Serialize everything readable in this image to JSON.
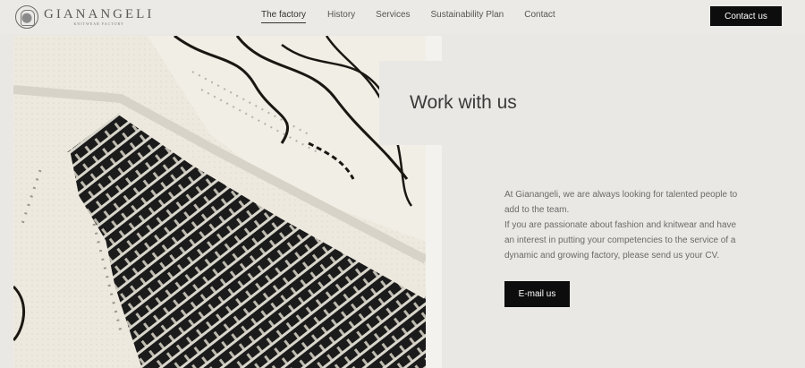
{
  "header": {
    "logo": {
      "name": "GIANANGELI",
      "tagline": "KNITWEAR FACTORY"
    },
    "nav": [
      {
        "label": "The factory",
        "active": true
      },
      {
        "label": "History"
      },
      {
        "label": "Services"
      },
      {
        "label": "Sustainability Plan"
      },
      {
        "label": "Contact"
      }
    ],
    "contact_button": "Contact us"
  },
  "main": {
    "title": "Work with us",
    "paragraph_1": "At Gianangeli, we are always looking for talented people to add to the team.",
    "paragraph_2": "If you are passionate about fashion and knitwear and have an interest in putting your competencies to the service of a dynamic and growing factory, please send us your CV.",
    "email_button": "E-mail us"
  },
  "colors": {
    "background": "#e9e8e4",
    "button": "#0d0d0d",
    "button_text": "#ffffff"
  }
}
